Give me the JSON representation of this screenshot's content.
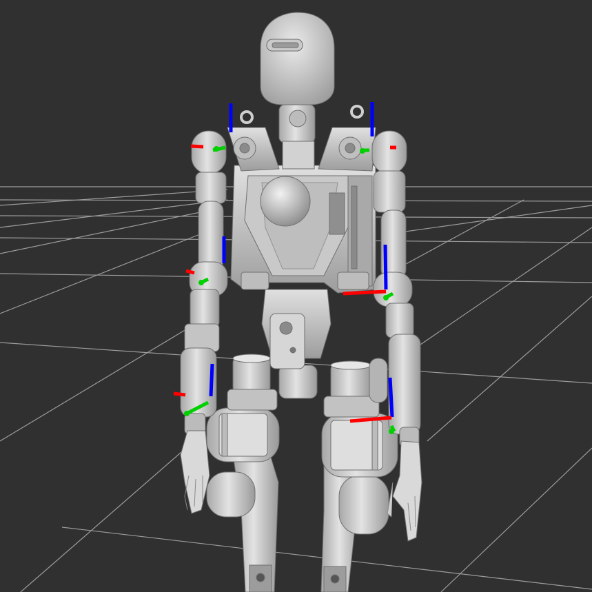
{
  "scene": {
    "background_color": "#303030",
    "grid_color": "#a9a9a9",
    "robot_color": "#cfcfcf",
    "axis_colors": {
      "x": "#ff0000",
      "y": "#00d000",
      "z": "#0000ff"
    },
    "frames": [
      {
        "name": "left-shoulder-frame"
      },
      {
        "name": "right-shoulder-frame"
      },
      {
        "name": "left-elbow-frame"
      },
      {
        "name": "right-elbow-frame"
      },
      {
        "name": "left-wrist-frame"
      },
      {
        "name": "right-wrist-frame"
      }
    ]
  }
}
